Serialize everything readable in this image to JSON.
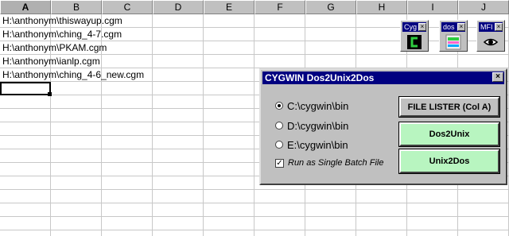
{
  "columns": [
    "A",
    "B",
    "C",
    "D",
    "E",
    "F",
    "G",
    "H",
    "I",
    "J"
  ],
  "cells": [
    "H:\\anthonym\\thiswayup.cgm",
    "H:\\anthonym\\ching_4-7.cgm",
    "H:\\anthonym\\PKAM.cgm",
    "H:\\anthonym\\ianlp.cgm",
    "H:\\anthonym\\ching_4-6_new.cgm"
  ],
  "tools": [
    {
      "title": "Cyg",
      "icon": "cygwin-icon"
    },
    {
      "title": "dos",
      "icon": "dos-box-icon"
    },
    {
      "title": "MFI",
      "icon": "eye-icon"
    }
  ],
  "dialog": {
    "title": "CYGWIN Dos2Unix2Dos",
    "close": "×",
    "options": [
      "C:\\cygwin\\bin",
      "D:\\cygwin\\bin",
      "E:\\cygwin\\bin"
    ],
    "selected_option": 0,
    "batch_label": "Run as Single Batch File",
    "batch_checked": true,
    "buttons": {
      "file_lister": "FILE LISTER (Col A)",
      "dos2unix": "Dos2Unix",
      "unix2dos": "Unix2Dos"
    }
  },
  "colors": {
    "titlebar": "#000080",
    "button_green": "#b8f5c0",
    "face": "#c0c0c0"
  }
}
